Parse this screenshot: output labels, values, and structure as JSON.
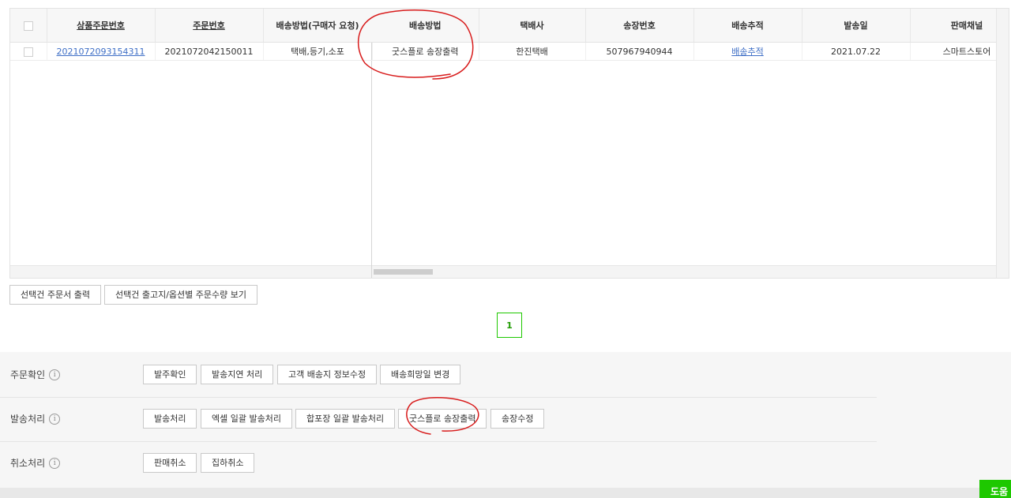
{
  "grid": {
    "left_headers": [
      "상품주문번호",
      "주문번호",
      "배송방법(구매자 요청)"
    ],
    "right_headers": [
      "배송방법",
      "택배사",
      "송장번호",
      "배송추적",
      "발송일",
      "판매채널"
    ],
    "row": {
      "product_order_no": "2021072093154311",
      "order_no": "2021072042150011",
      "requested_method": "택배,등기,소포",
      "delivery_method": "굿스플로 송장출력",
      "carrier": "한진택배",
      "tracking_no": "507967940944",
      "tracking_link": "배송추적",
      "ship_date": "2021.07.22",
      "channel": "스마트스토어"
    }
  },
  "grid_buttons": {
    "print_order": "선택건 주문서 출력",
    "view_qty": "선택건 출고지/옵션별 주문수량 보기"
  },
  "pagination": {
    "current": "1"
  },
  "panel": {
    "order_confirm": {
      "label": "주문확인",
      "buttons": [
        "발주확인",
        "발송지연 처리",
        "고객 배송지 정보수정",
        "배송희망일 변경"
      ]
    },
    "shipping": {
      "label": "발송처리",
      "buttons": [
        "발송처리",
        "엑셀 일괄 발송처리",
        "합포장 일괄 발송처리",
        "굿스플로 송장출력",
        "송장수정"
      ]
    },
    "cancel": {
      "label": "취소처리",
      "buttons": [
        "판매취소",
        "집하취소"
      ]
    },
    "info_glyph": "i"
  },
  "help": {
    "label": "도움"
  },
  "annotation_color": "#d81c1c",
  "accent_color": "#1ec800"
}
